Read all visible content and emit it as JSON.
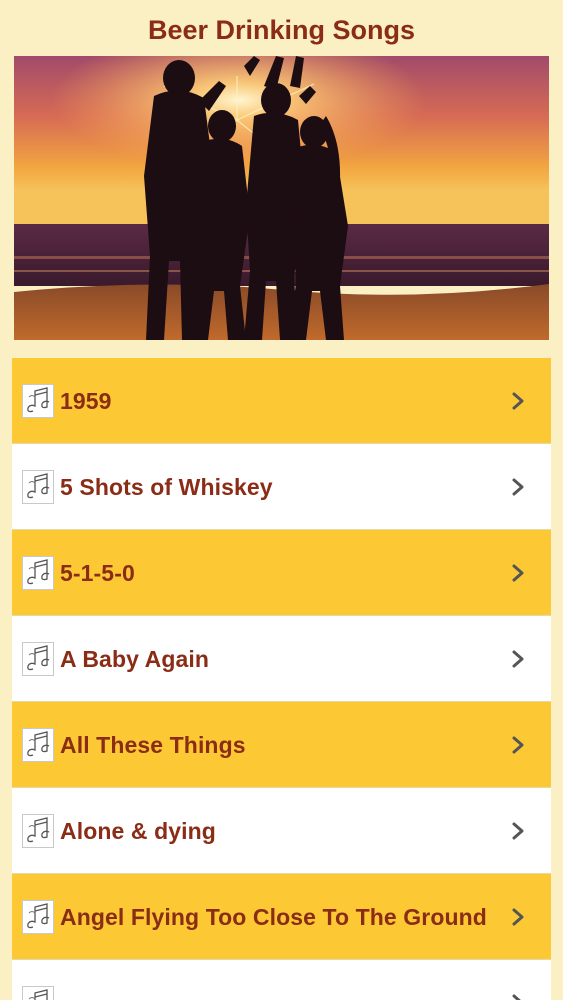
{
  "header": {
    "title": "Beer Drinking Songs"
  },
  "banner": {
    "image": "beach-party-sunset-photo"
  },
  "songs": [
    {
      "label": "1959",
      "style": "yellow"
    },
    {
      "label": "5 Shots of Whiskey",
      "style": "white"
    },
    {
      "label": "5-1-5-0",
      "style": "yellow"
    },
    {
      "label": "A Baby Again",
      "style": "white"
    },
    {
      "label": "All These Things",
      "style": "yellow"
    },
    {
      "label": "Alone & dying",
      "style": "white"
    },
    {
      "label": "Angel Flying Too Close To The Ground",
      "style": "yellow"
    },
    {
      "label": "",
      "style": "white"
    }
  ],
  "icons": {
    "row_icon": "music-note-icon",
    "row_arrow": "chevron-right-icon"
  },
  "colors": {
    "background": "#fbefc4",
    "accent": "#fcc934",
    "text": "#8a2c16"
  }
}
